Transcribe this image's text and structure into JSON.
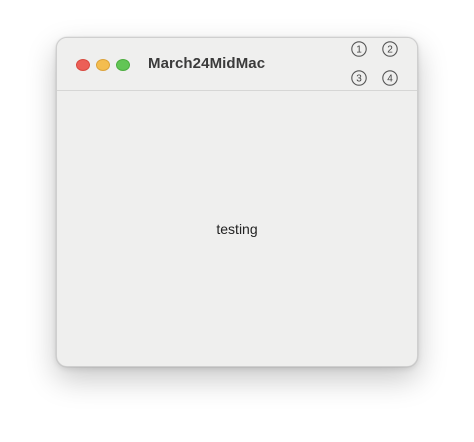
{
  "window": {
    "title": "March24MidMac",
    "controls": [
      {
        "name": "close",
        "color": "#ec5f57"
      },
      {
        "name": "minimize",
        "color": "#f4bd4f"
      },
      {
        "name": "zoom",
        "color": "#62c555"
      }
    ]
  },
  "toolbar": {
    "buttons": [
      {
        "label": "1",
        "icon": "circled-number-one-icon"
      },
      {
        "label": "2",
        "icon": "circled-number-two-icon"
      },
      {
        "label": "3",
        "icon": "circled-number-three-icon"
      },
      {
        "label": "4",
        "icon": "circled-number-four-icon"
      }
    ]
  },
  "content": {
    "text": "testing"
  }
}
